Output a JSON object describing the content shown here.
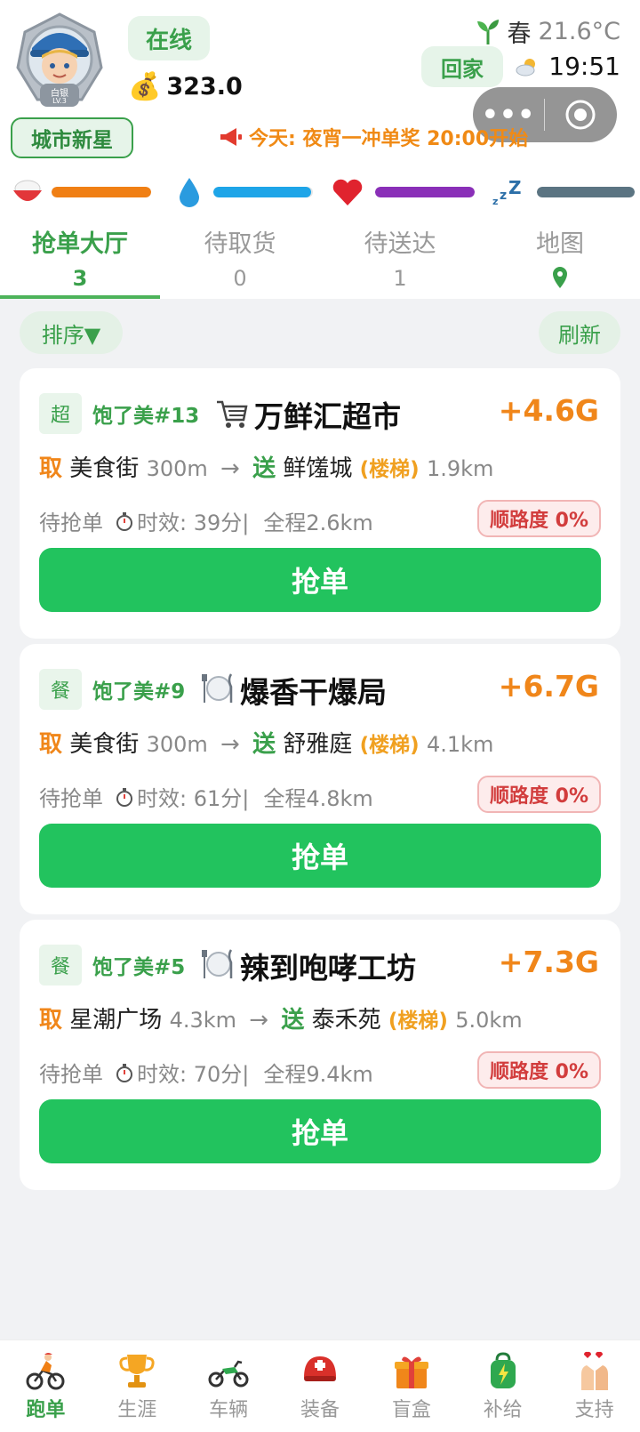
{
  "header": {
    "avatar_rank": "白银",
    "avatar_level": "LV.3",
    "status": "在线",
    "money": "323.0",
    "season": "春",
    "temperature": "21.6°C",
    "home_button": "回家",
    "time": "19:51",
    "capsule_more": "•••",
    "title": "城市新星",
    "announcement": "今天: 夜宵一冲单奖 20:00开始"
  },
  "stat_bars": [
    {
      "icon": "rice-bowl-icon",
      "color": "#f07f14",
      "level": 1.0
    },
    {
      "icon": "water-drop-icon",
      "color": "#1ea5e8",
      "level": 0.98
    },
    {
      "icon": "heart-icon",
      "color": "#8a2fb8",
      "level": 1.0
    },
    {
      "icon": "sleep-icon",
      "color": "#5b7482",
      "level": 1.0
    }
  ],
  "tabs": [
    {
      "label": "抢单大厅",
      "count": "3"
    },
    {
      "label": "待取货",
      "count": "0"
    },
    {
      "label": "待送达",
      "count": "1"
    },
    {
      "label": "地图",
      "icon": "map-pin-icon"
    }
  ],
  "controls": {
    "sort": "排序▼",
    "refresh": "刷新"
  },
  "orders": [
    {
      "tag": "超",
      "store_no": "饱了美#13",
      "cat_icon": "cart-icon",
      "shop": "万鲜汇超市",
      "reward": "+4.6G",
      "pick_label": "取",
      "pick_place": "美食街",
      "pick_dist": "300m",
      "arrow": "→",
      "drop_label": "送",
      "drop_place": "鲜馐城",
      "stairs": "(楼梯)",
      "drop_dist": "1.9km",
      "state": "待抢单",
      "time_limit": "时效: 39分|",
      "total": "全程2.6km",
      "smoothness": "顺路度 0%",
      "button": "抢单"
    },
    {
      "tag": "餐",
      "store_no": "饱了美#9",
      "cat_icon": "dining-icon",
      "shop": "爆香干爆局",
      "reward": "+6.7G",
      "pick_label": "取",
      "pick_place": "美食街",
      "pick_dist": "300m",
      "arrow": "→",
      "drop_label": "送",
      "drop_place": "舒雅庭",
      "stairs": "(楼梯)",
      "drop_dist": "4.1km",
      "state": "待抢单",
      "time_limit": "时效: 61分|",
      "total": "全程4.8km",
      "smoothness": "顺路度 0%",
      "button": "抢单"
    },
    {
      "tag": "餐",
      "store_no": "饱了美#5",
      "cat_icon": "dining-icon",
      "shop": "辣到咆哮工坊",
      "reward": "+7.3G",
      "pick_label": "取",
      "pick_place": "星潮广场",
      "pick_dist": "4.3km",
      "arrow": "→",
      "drop_label": "送",
      "drop_place": "泰禾苑",
      "stairs": "(楼梯)",
      "drop_dist": "5.0km",
      "state": "待抢单",
      "time_limit": "时效: 70分|",
      "total": "全程9.4km",
      "smoothness": "顺路度 0%",
      "button": "抢单"
    }
  ],
  "bottom_nav": [
    {
      "label": "跑单",
      "icon": "cyclist-icon"
    },
    {
      "label": "生涯",
      "icon": "trophy-icon"
    },
    {
      "label": "车辆",
      "icon": "motorcycle-icon"
    },
    {
      "label": "装备",
      "icon": "helmet-icon"
    },
    {
      "label": "盲盒",
      "icon": "gift-box-icon"
    },
    {
      "label": "补给",
      "icon": "backpack-icon"
    },
    {
      "label": "支持",
      "icon": "heart-hands-icon"
    }
  ],
  "colors": {
    "brand_green": "#3aa04b",
    "button_green": "#22c35e",
    "reward_orange": "#f0861a",
    "background": "#f1f2f4"
  }
}
